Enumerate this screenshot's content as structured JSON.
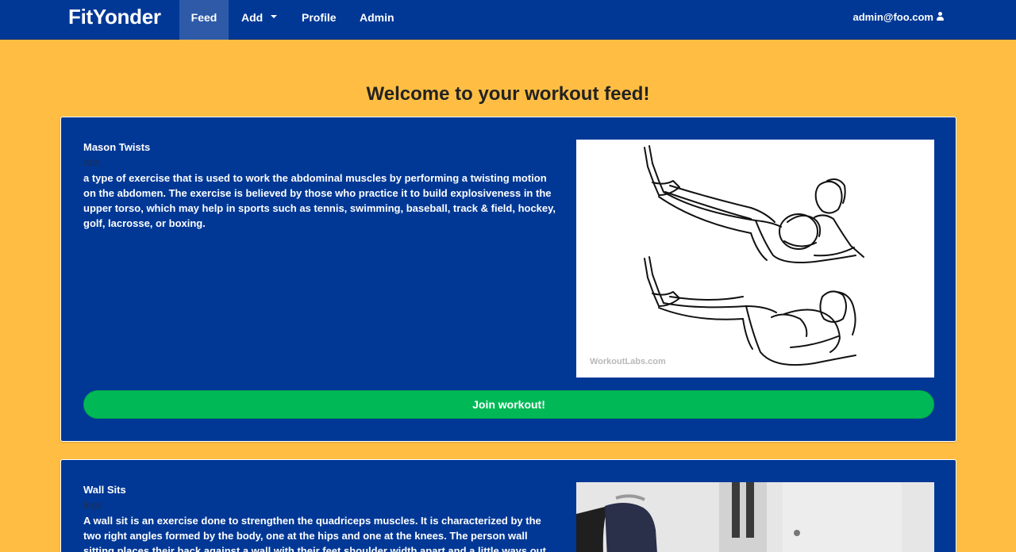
{
  "app": {
    "brand": "FitYonder"
  },
  "nav": {
    "feed": "Feed",
    "add": "Add",
    "profile": "Profile",
    "admin": "Admin",
    "user": "admin@foo.com"
  },
  "page": {
    "title": "Welcome to your workout feed!"
  },
  "workouts": [
    {
      "name": "Mason Twists",
      "category": "abs",
      "description": "a type of exercise that is used to work the abdominal muscles by performing a twisting motion on the abdomen. The exercise is believed by those who practice it to build explosiveness in the upper torso, which may help in sports such as tennis, swimming, baseball, track & field, hockey, golf, lacrosse, or boxing.",
      "image_watermark": "WorkoutLabs.com",
      "join_label": "Join workout!"
    },
    {
      "name": "Wall Sits",
      "category": "legs",
      "description": "A wall sit is an exercise done to strengthen the quadriceps muscles. It is characterized by the two right angles formed by the body, one at the hips and one at the knees. The person wall sitting places their back against a wall with their feet shoulder width apart and a little ways out from the wall."
    }
  ],
  "colors": {
    "navbar": "#013896",
    "page_background": "#FFBE43",
    "card": "#013896",
    "join_button": "#00B956"
  },
  "icons": {
    "user": "user-icon",
    "add_dropdown": "caret-down-icon"
  }
}
